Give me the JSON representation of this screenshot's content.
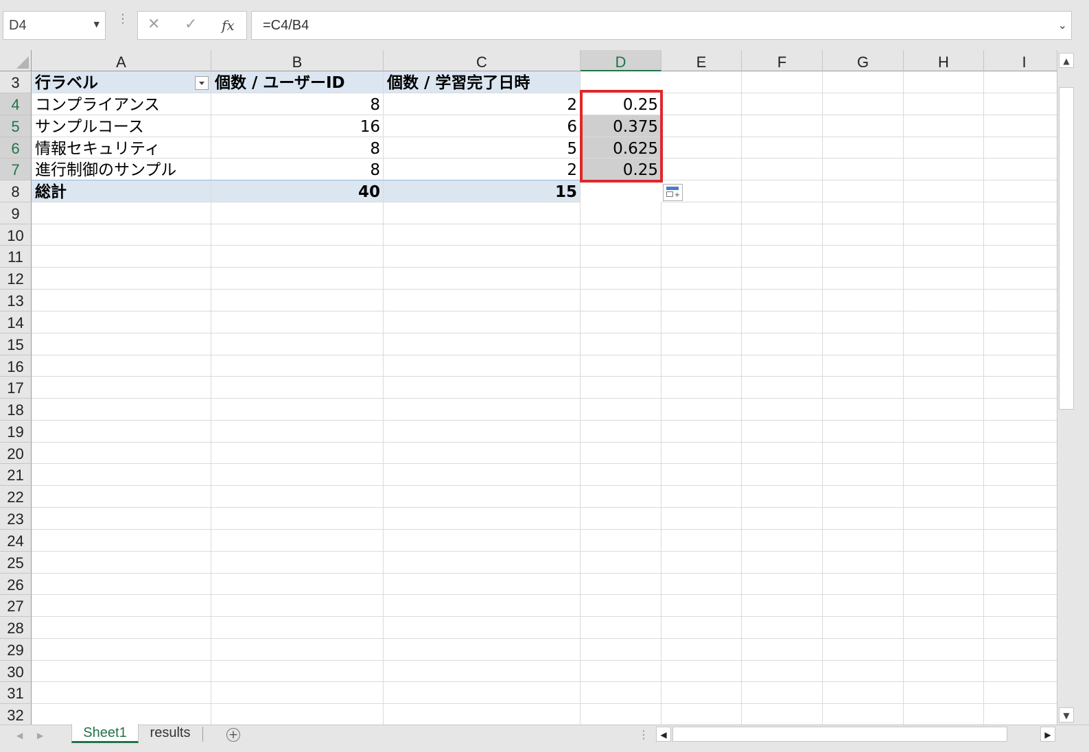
{
  "name_box": "D4",
  "formula": "=C4/B4",
  "columns": [
    "A",
    "B",
    "C",
    "D",
    "E",
    "F",
    "G",
    "H",
    "I"
  ],
  "rows": [
    "3",
    "4",
    "5",
    "6",
    "7",
    "8",
    "9",
    "10",
    "11",
    "12",
    "13",
    "14",
    "15",
    "16",
    "17",
    "18",
    "19",
    "20",
    "21",
    "22",
    "23",
    "24",
    "25",
    "26",
    "27",
    "28",
    "29",
    "30",
    "31",
    "32"
  ],
  "pivot": {
    "header": {
      "row_label": "行ラベル",
      "count_user": "個数 / ユーザーID",
      "count_done": "個数 / 学習完了日時"
    },
    "rows": [
      {
        "label": "コンプライアンス",
        "b": "8",
        "c": "2",
        "d": "0.25"
      },
      {
        "label": "サンプルコース",
        "b": "16",
        "c": "6",
        "d": "0.375"
      },
      {
        "label": "情報セキュリティ",
        "b": "8",
        "c": "5",
        "d": "0.625"
      },
      {
        "label": "進行制御のサンプル",
        "b": "8",
        "c": "2",
        "d": "0.25"
      }
    ],
    "total": {
      "label": "総計",
      "b": "40",
      "c": "15"
    }
  },
  "sheets": {
    "active": "Sheet1",
    "other": "results"
  },
  "colors": {
    "accent": "#217346",
    "highlight": "#e0262b",
    "pivot_band": "#dce6f1"
  }
}
